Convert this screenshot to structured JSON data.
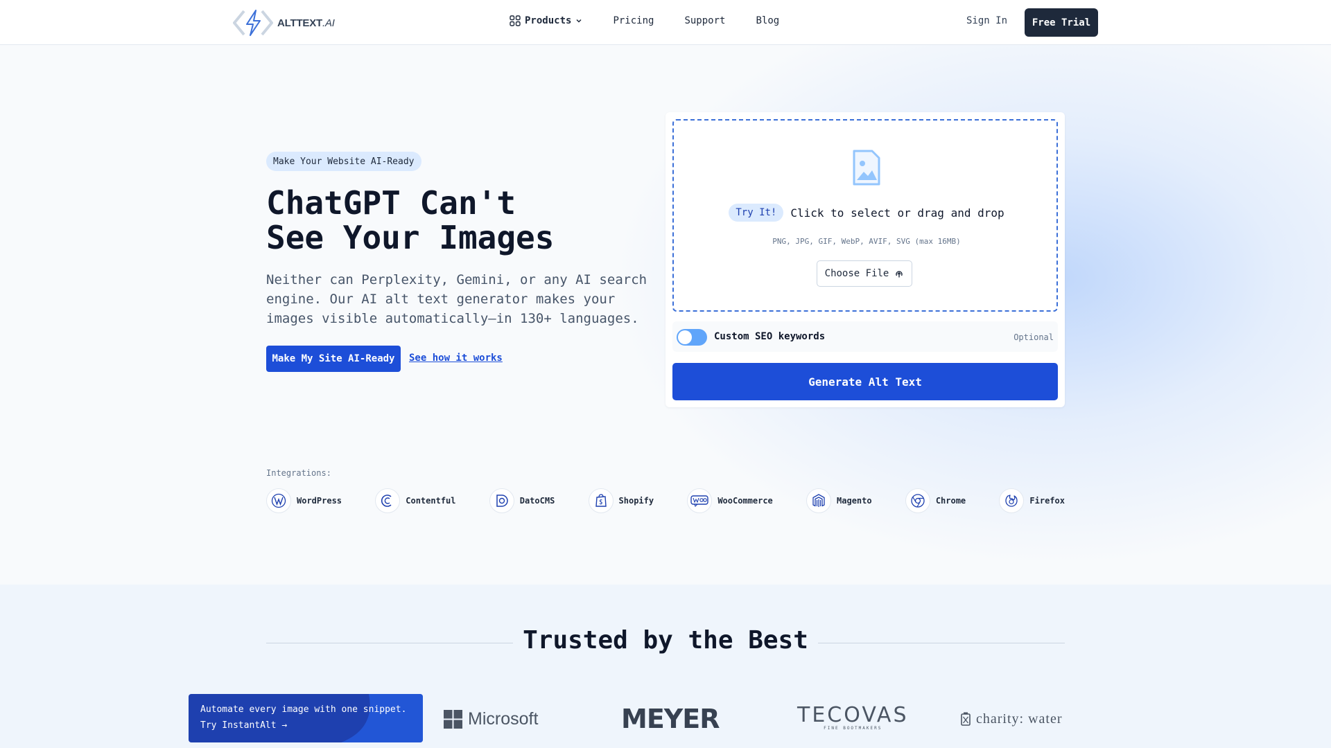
{
  "nav": {
    "logo_text": "ALTTEXT",
    "logo_suffix": ".AI",
    "links": [
      "Products",
      "Pricing",
      "Support",
      "Blog"
    ],
    "sign_in": "Sign In",
    "free_trial": "Free Trial"
  },
  "hero": {
    "tag": "Make Your Website AI-Ready",
    "title_line1": "ChatGPT Can't",
    "title_line2": "See Your Images",
    "subtitle": "Neither can Perplexity, Gemini, or any AI search engine. Our AI alt text generator makes your images visible automatically—in 130+ languages.",
    "cta": "Make My Site AI-Ready",
    "how": "See how it works"
  },
  "upload": {
    "try_badge": "Try It!",
    "instruction": "Click to select or drag and drop",
    "formats": "PNG, JPG, GIF, WebP, AVIF, SVG (max 16MB)",
    "choose_file": "Choose File",
    "seo_label": "Custom SEO keywords",
    "optional": "Optional",
    "generate": "Generate Alt Text",
    "seo_toggle_on": false
  },
  "integrations": {
    "label": "Integrations:",
    "items": [
      "WordPress",
      "Contentful",
      "DatoCMS",
      "Shopify",
      "WooCommerce",
      "Magento",
      "Chrome",
      "Firefox"
    ]
  },
  "trusted": {
    "title": "Trusted by the Best",
    "promo_line1": "Automate every image with one snippet.",
    "promo_line2": "Try InstantAlt →",
    "brands": {
      "microsoft": "Microsoft",
      "meyer": "MEYER",
      "tecovas": "TECOVAS",
      "tecovas_sub": "FINE BOOTMAKERS",
      "charity": "charity: water"
    }
  },
  "colors": {
    "accent": "#1d4ed8",
    "dark_button": "#1e293b",
    "badge_bg": "#dbeafe"
  }
}
